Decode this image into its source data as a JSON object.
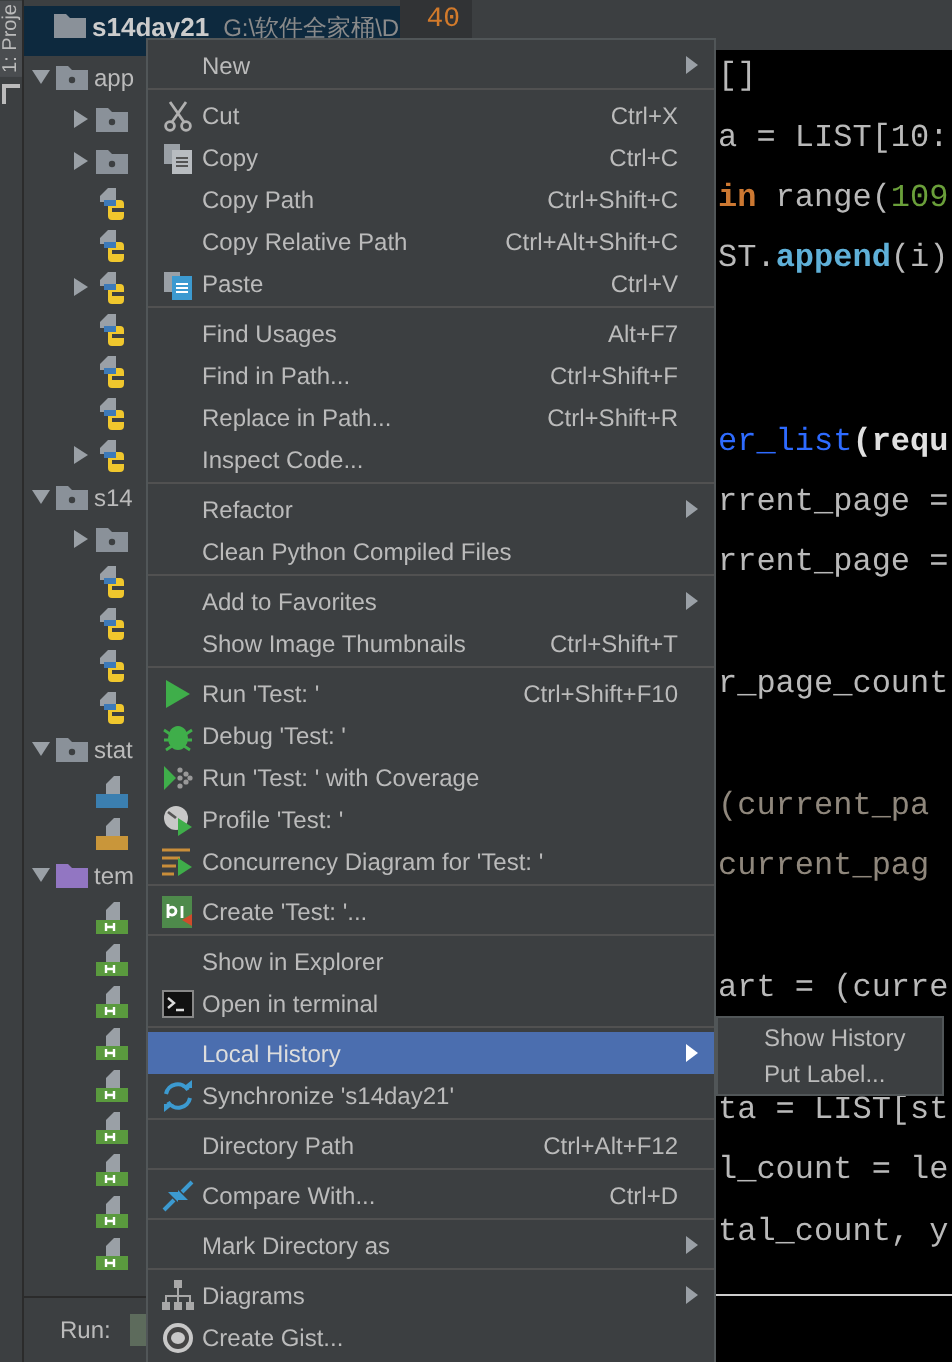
{
  "tool_strip": {
    "tab": "1: Proje"
  },
  "project_tree": {
    "root": {
      "label": "s14day21",
      "path": "G:\\软件全家桶\\D",
      "kind": "folder"
    },
    "items": [
      {
        "label": "app",
        "kind": "module-folder",
        "expanded": true,
        "children": [
          {
            "kind": "module-folder",
            "expanded": false
          },
          {
            "kind": "module-folder",
            "expanded": false
          },
          {
            "kind": "python-file"
          },
          {
            "kind": "python-file"
          },
          {
            "kind": "python-package",
            "expanded": false
          },
          {
            "kind": "python-file"
          },
          {
            "kind": "python-file"
          },
          {
            "kind": "python-file"
          },
          {
            "kind": "python-package",
            "expanded": false
          }
        ]
      },
      {
        "label": "s14",
        "kind": "module-folder",
        "expanded": true,
        "children": [
          {
            "kind": "module-folder",
            "expanded": false
          },
          {
            "kind": "python-file"
          },
          {
            "kind": "python-file"
          },
          {
            "kind": "python-file"
          },
          {
            "kind": "python-file"
          }
        ]
      },
      {
        "label": "stat",
        "kind": "module-folder",
        "expanded": true,
        "children": [
          {
            "kind": "css-file"
          },
          {
            "kind": "js-file"
          }
        ]
      },
      {
        "label": "tem",
        "kind": "template-folder",
        "expanded": true,
        "children": [
          {
            "kind": "html-file"
          },
          {
            "kind": "html-file"
          },
          {
            "kind": "html-file"
          },
          {
            "kind": "html-file"
          },
          {
            "kind": "html-file"
          },
          {
            "kind": "html-file"
          },
          {
            "kind": "html-file"
          },
          {
            "kind": "html-file"
          },
          {
            "kind": "html-file"
          }
        ]
      }
    ]
  },
  "run_bar": {
    "label": "Run:"
  },
  "editor": {
    "line_number": "40",
    "lines": [
      {
        "kind": "code",
        "tokens": [
          {
            "text": "[]",
            "kind": "plain"
          }
        ]
      },
      {
        "kind": "code",
        "tokens": [
          {
            "text": "a = LIST[10:",
            "kind": "plain"
          }
        ]
      },
      {
        "kind": "code",
        "tokens": [
          {
            "text": "in",
            "kind": "keyword"
          },
          {
            "text": " range(",
            "kind": "plain"
          },
          {
            "text": "109",
            "kind": "number"
          }
        ]
      },
      {
        "kind": "code",
        "tokens": [
          {
            "text": "ST.",
            "kind": "plain"
          },
          {
            "text": "append",
            "kind": "method"
          },
          {
            "text": "(i)",
            "kind": "plain"
          }
        ]
      },
      {
        "kind": "blank"
      },
      {
        "kind": "blank"
      },
      {
        "kind": "code",
        "tokens": [
          {
            "text": "er_list",
            "kind": "definition"
          },
          {
            "text": "(requ",
            "kind": "parameter"
          }
        ]
      },
      {
        "kind": "code",
        "tokens": [
          {
            "text": "rrent_page =",
            "kind": "plain"
          }
        ]
      },
      {
        "kind": "code",
        "tokens": [
          {
            "text": "rrent_page =",
            "kind": "plain"
          }
        ]
      },
      {
        "kind": "blank"
      },
      {
        "kind": "code",
        "tokens": [
          {
            "text": "r_page_count",
            "kind": "plain"
          }
        ]
      },
      {
        "kind": "blank"
      },
      {
        "kind": "code",
        "tokens": [
          {
            "text": "(current_pa",
            "kind": "dim"
          }
        ]
      },
      {
        "kind": "code",
        "tokens": [
          {
            "text": "current_pag",
            "kind": "dim"
          }
        ]
      },
      {
        "kind": "blank"
      },
      {
        "kind": "code",
        "tokens": [
          {
            "text": "art = (curre",
            "kind": "plain"
          }
        ]
      },
      {
        "kind": "blank"
      },
      {
        "kind": "code",
        "tokens": [
          {
            "text": "ta = LIST[st",
            "kind": "plain"
          }
        ]
      },
      {
        "kind": "code",
        "tokens": [
          {
            "text": "l_count = le",
            "kind": "plain"
          }
        ]
      },
      {
        "kind": "code",
        "tokens": [
          {
            "text": "tal_count, y",
            "kind": "plain"
          }
        ]
      }
    ]
  },
  "context_menu": {
    "items": [
      {
        "kind": "item",
        "label": "New",
        "submenu": true,
        "selected": false
      },
      {
        "kind": "separator"
      },
      {
        "kind": "item",
        "label": "Cut",
        "shortcut": "Ctrl+X",
        "selected": false
      },
      {
        "kind": "item",
        "label": "Copy",
        "shortcut": "Ctrl+C",
        "selected": false
      },
      {
        "kind": "item",
        "label": "Copy Path",
        "shortcut": "Ctrl+Shift+C",
        "selected": false
      },
      {
        "kind": "item",
        "label": "Copy Relative Path",
        "shortcut": "Ctrl+Alt+Shift+C",
        "selected": false
      },
      {
        "kind": "item",
        "label": "Paste",
        "shortcut": "Ctrl+V",
        "selected": false
      },
      {
        "kind": "separator"
      },
      {
        "kind": "item",
        "label": "Find Usages",
        "shortcut": "Alt+F7",
        "selected": false
      },
      {
        "kind": "item",
        "label": "Find in Path...",
        "shortcut": "Ctrl+Shift+F",
        "selected": false
      },
      {
        "kind": "item",
        "label": "Replace in Path...",
        "shortcut": "Ctrl+Shift+R",
        "selected": false
      },
      {
        "kind": "item",
        "label": "Inspect Code...",
        "selected": false
      },
      {
        "kind": "separator"
      },
      {
        "kind": "item",
        "label": "Refactor",
        "submenu": true,
        "selected": false
      },
      {
        "kind": "item",
        "label": "Clean Python Compiled Files",
        "selected": false
      },
      {
        "kind": "separator"
      },
      {
        "kind": "item",
        "label": "Add to Favorites",
        "submenu": true,
        "selected": false
      },
      {
        "kind": "item",
        "label": "Show Image Thumbnails",
        "shortcut": "Ctrl+Shift+T",
        "selected": false
      },
      {
        "kind": "separator"
      },
      {
        "kind": "item",
        "label": "Run 'Test: '",
        "shortcut": "Ctrl+Shift+F10",
        "selected": false
      },
      {
        "kind": "item",
        "label": "Debug 'Test: '",
        "selected": false
      },
      {
        "kind": "item",
        "label": "Run 'Test: ' with Coverage",
        "selected": false
      },
      {
        "kind": "item",
        "label": "Profile 'Test: '",
        "selected": false
      },
      {
        "kind": "item",
        "label": "Concurrency Diagram for 'Test: '",
        "selected": false
      },
      {
        "kind": "separator"
      },
      {
        "kind": "item",
        "label": "Create 'Test: '...",
        "selected": false
      },
      {
        "kind": "separator"
      },
      {
        "kind": "item",
        "label": "Show in Explorer",
        "selected": false
      },
      {
        "kind": "item",
        "label": "Open in terminal",
        "selected": false
      },
      {
        "kind": "separator"
      },
      {
        "kind": "item",
        "label": "Local History",
        "submenu": true,
        "selected": true
      },
      {
        "kind": "item",
        "label": "Synchronize 's14day21'",
        "selected": false
      },
      {
        "kind": "separator"
      },
      {
        "kind": "item",
        "label": "Directory Path",
        "shortcut": "Ctrl+Alt+F12",
        "selected": false
      },
      {
        "kind": "separator"
      },
      {
        "kind": "item",
        "label": "Compare With...",
        "shortcut": "Ctrl+D",
        "selected": false
      },
      {
        "kind": "separator"
      },
      {
        "kind": "item",
        "label": "Mark Directory as",
        "submenu": true,
        "selected": false
      },
      {
        "kind": "separator"
      },
      {
        "kind": "item",
        "label": "Diagrams",
        "submenu": true,
        "selected": false
      },
      {
        "kind": "item",
        "label": "Create Gist...",
        "selected": false
      }
    ]
  },
  "submenu": {
    "items": [
      {
        "label": "Show History"
      },
      {
        "label": "Put Label..."
      }
    ]
  }
}
